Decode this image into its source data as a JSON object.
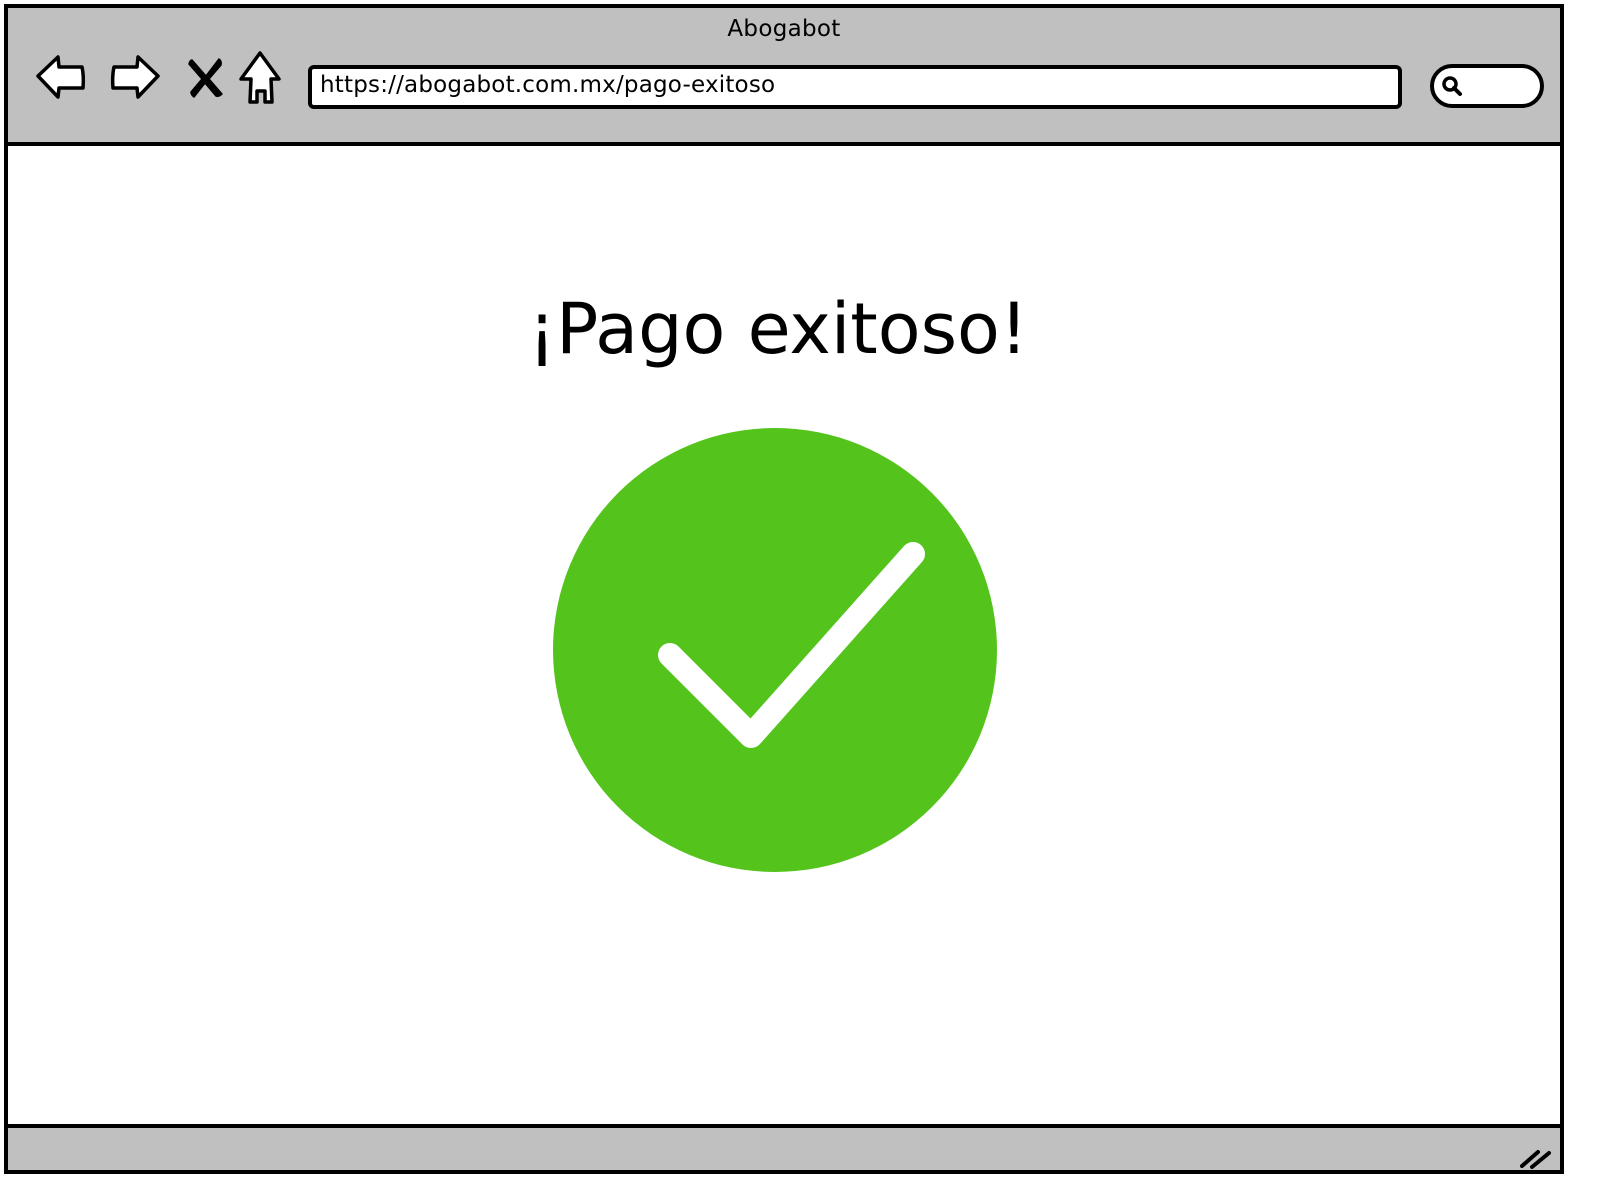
{
  "window": {
    "title": "Abogabot"
  },
  "toolbar": {
    "back_icon": "back-arrow-icon",
    "forward_icon": "forward-arrow-icon",
    "stop_icon": "close-icon",
    "home_icon": "home-icon",
    "url": "https://abogabot.com.mx/pago-exitoso",
    "search_icon": "search-icon",
    "search_value": ""
  },
  "main": {
    "heading": "¡Pago exitoso!",
    "status_icon": "checkmark-circle-icon",
    "status_color": "#54c41c"
  },
  "statusbar": {
    "grip_icon": "resize-grip-icon"
  }
}
